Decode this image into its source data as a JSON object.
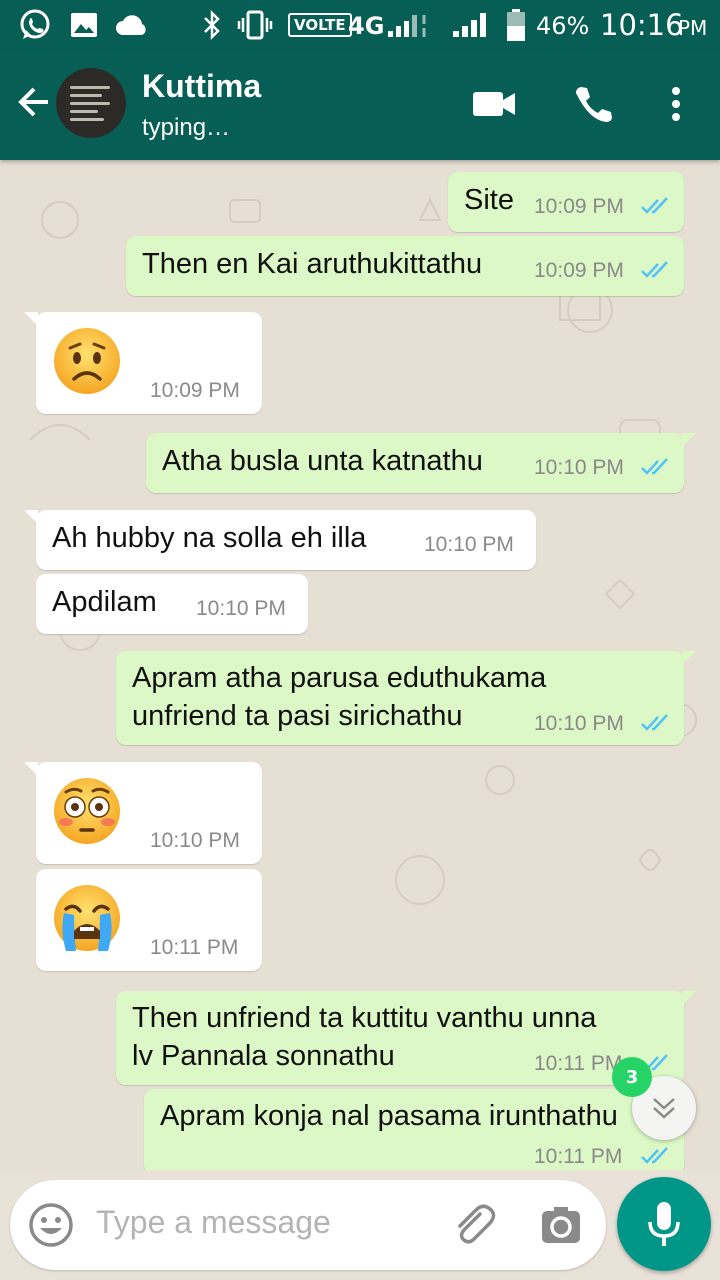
{
  "status_bar": {
    "volte": "VOLTE",
    "network": "4G",
    "battery": "46%",
    "time": "10:16",
    "ampm": "PM",
    "icons": [
      "whatsapp-icon",
      "image-icon",
      "cloud-icon",
      "bluetooth-icon",
      "vibrate-icon",
      "signal-icon",
      "battery-icon"
    ]
  },
  "header": {
    "contact_name": "Kuttima",
    "contact_status": "typing…",
    "icons": [
      "back-arrow-icon",
      "video-call-icon",
      "phone-call-icon",
      "more-vert-icon"
    ]
  },
  "messages": [
    {
      "dir": "out",
      "text": "Site",
      "time": "10:09 PM",
      "read": true
    },
    {
      "dir": "out",
      "text": "Then en Kai aruthukittathu",
      "time": "10:09 PM",
      "read": true
    },
    {
      "dir": "in",
      "emoji": "worried-face",
      "time": "10:09 PM"
    },
    {
      "dir": "out",
      "text": "Atha busla unta katnathu",
      "time": "10:10 PM",
      "read": true
    },
    {
      "dir": "in",
      "text": "Ah hubby na solla eh illa",
      "time": "10:10 PM"
    },
    {
      "dir": "in",
      "text": "Apdilam",
      "time": "10:10 PM"
    },
    {
      "dir": "out",
      "line1": "Apram atha parusa eduthukama",
      "line2": "unfriend ta pasi sirichathu",
      "time": "10:10 PM",
      "read": true
    },
    {
      "dir": "in",
      "emoji": "flushed-face",
      "time": "10:10 PM"
    },
    {
      "dir": "in",
      "emoji": "loudly-crying-face",
      "time": "10:11 PM"
    },
    {
      "dir": "out",
      "line1": "Then unfriend ta kuttitu vanthu unna",
      "line2": "lv Pannala sonnathu",
      "time": "10:11 PM",
      "read": true
    },
    {
      "dir": "out",
      "text": "Apram konja nal pasama irunthathu",
      "time": "10:11 PM",
      "read": true
    }
  ],
  "scroll_button": {
    "unread_count": "3",
    "icon": "double-chevron-down-icon"
  },
  "input": {
    "placeholder": "Type a message",
    "icons": [
      "emoji-icon",
      "attach-icon",
      "camera-icon",
      "mic-icon"
    ]
  },
  "colors": {
    "header": "#075e54",
    "outgoing_bubble": "#dcf8c6",
    "incoming_bubble": "#ffffff",
    "read_ticks": "#4fc3f7",
    "accent": "#009688",
    "badge": "#25d366"
  }
}
